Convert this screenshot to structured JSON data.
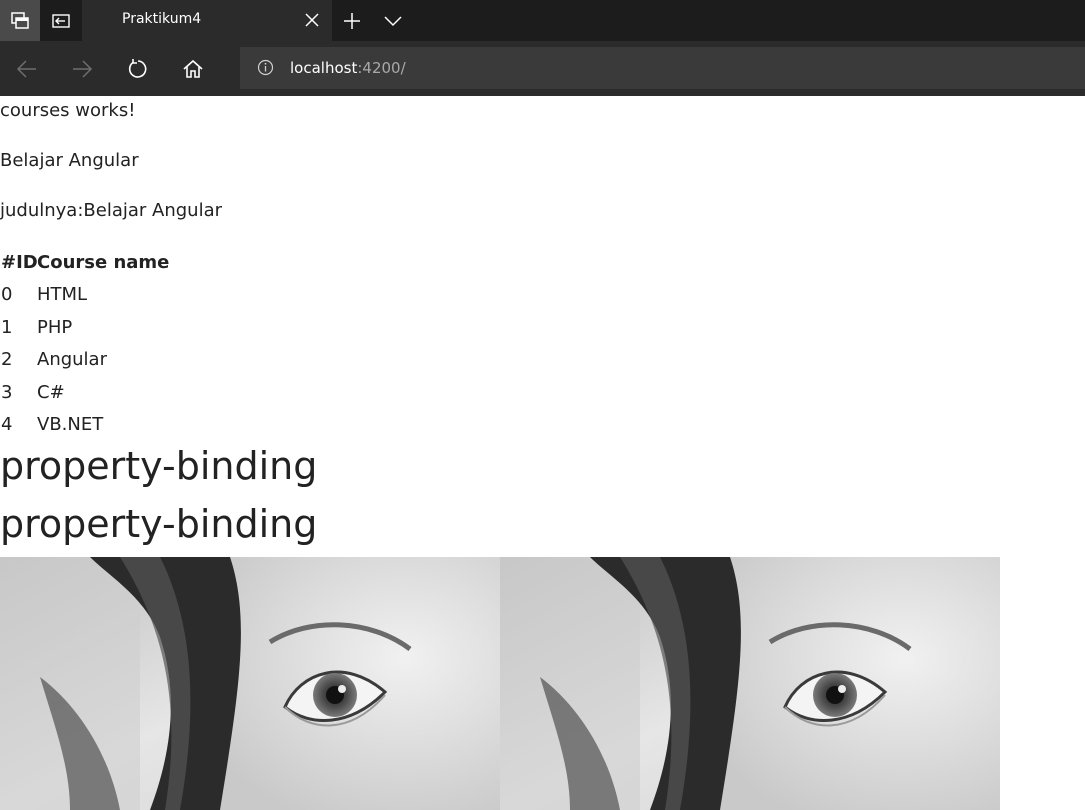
{
  "browser": {
    "tab_title": "Praktikum4",
    "url_host": "localhost",
    "url_rest": ":4200/",
    "icons": {
      "tab_actions": "tab-actions-icon",
      "tabs_aside": "tabs-aside-icon",
      "close": "close-icon",
      "new_tab": "plus-icon",
      "tab_list": "chevron-down-icon",
      "back": "back-arrow-icon",
      "forward": "forward-arrow-icon",
      "refresh": "refresh-icon",
      "home": "home-icon",
      "info": "info-icon"
    }
  },
  "page": {
    "line1": "courses works!",
    "line2": "Belajar Angular",
    "line3": "judulnya:Belajar Angular",
    "table": {
      "headers": [
        "#ID",
        "Course name"
      ],
      "rows": [
        {
          "id": "0",
          "name": "HTML"
        },
        {
          "id": "1",
          "name": "PHP"
        },
        {
          "id": "2",
          "name": "Angular"
        },
        {
          "id": "3",
          "name": "C#"
        },
        {
          "id": "4",
          "name": "VB.NET"
        }
      ]
    },
    "heading1": "property-binding",
    "heading2": "property-binding"
  }
}
